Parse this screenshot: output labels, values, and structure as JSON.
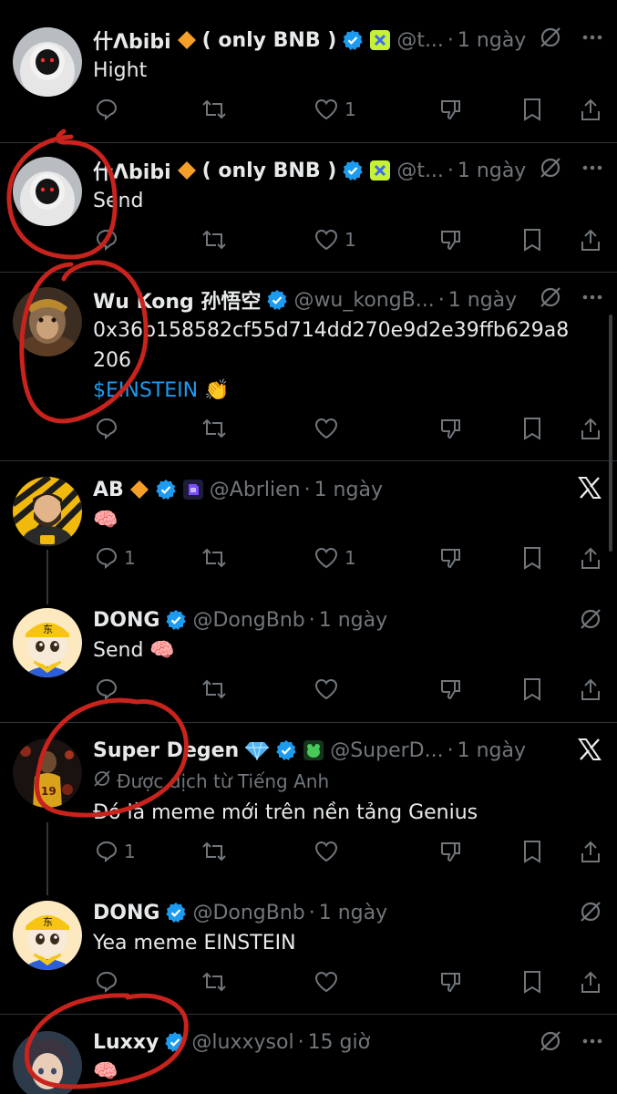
{
  "tweets": [
    {
      "display_name": "什Λbibi",
      "name_suffix": "( only BNB )",
      "handle": "@t...",
      "dot": "·",
      "time": "1 ngày",
      "text": "Hight",
      "reply_count": "",
      "retweet_count": "",
      "like_count": "1",
      "avatar_icon": "hooded-figure"
    },
    {
      "display_name": "什Λbibi",
      "name_suffix": "( only BNB )",
      "handle": "@t...",
      "dot": "·",
      "time": "1 ngày",
      "text": "Send",
      "reply_count": "",
      "retweet_count": "",
      "like_count": "1",
      "avatar_icon": "hooded-figure"
    },
    {
      "display_name": "Wu Kong 孙悟空",
      "handle": "@wu_kongB...",
      "dot": "·",
      "time": "1 ngày",
      "text": "0x36b158582cf55d714dd270e9d2e39ffb629a8206",
      "text_line1": "0x36b158582cf55d714dd270e9d2e39ffb629a8",
      "text_line2": "206",
      "cashtag": "$EINSTEIN",
      "emoji": "👏",
      "reply_count": "",
      "retweet_count": "",
      "like_count": "",
      "avatar_icon": "monkey-king"
    },
    {
      "display_name": "AB",
      "handle": "@Abrlien",
      "dot": "·",
      "time": "1 ngày",
      "text": "🧠",
      "reply_count": "1",
      "retweet_count": "",
      "like_count": "1",
      "avatar_icon": "bearded-man-cartoon"
    },
    {
      "display_name": "DONG",
      "handle": "@DongBnb",
      "dot": "·",
      "time": "1 ngày",
      "text": "Send 🧠",
      "reply_count": "",
      "retweet_count": "",
      "like_count": "",
      "avatar_icon": "cat-with-cap",
      "cap_text": "东"
    },
    {
      "display_name": "Super Degen",
      "handle": "@SuperD...",
      "dot": "·",
      "time": "1 ngày",
      "translated_label": "Được dịch từ Tiếng Anh",
      "text": "Đó là meme mới trên nền tảng Genius",
      "reply_count": "1",
      "retweet_count": "",
      "like_count": "",
      "avatar_icon": "basketball-player",
      "jersey_number": "19"
    },
    {
      "display_name": "DONG",
      "handle": "@DongBnb",
      "dot": "·",
      "time": "1 ngày",
      "text": "Yea meme EINSTEIN",
      "reply_count": "",
      "retweet_count": "",
      "like_count": "",
      "avatar_icon": "cat-with-cap",
      "cap_text": "东"
    },
    {
      "display_name": "Luxxy",
      "handle": "@luxxysol",
      "dot": "·",
      "time": "15 giờ",
      "text": "🧠",
      "avatar_icon": "anime-character"
    }
  ],
  "colors": {
    "background": "#000000",
    "text": "#e7e9ea",
    "muted": "#71767b",
    "link": "#1d9bf0",
    "verified": "#1d9bf0",
    "annotation": "#c8231c"
  }
}
